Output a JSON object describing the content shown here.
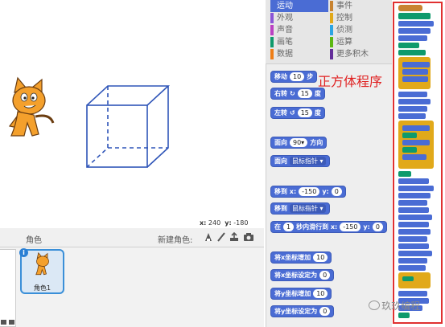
{
  "stage": {
    "coords": {
      "x_label": "x:",
      "x_value": "240",
      "y_label": "y:",
      "y_value": "-180"
    }
  },
  "sprites": {
    "title": "角色",
    "new_sprite_label": "新建角色:",
    "tools": [
      "paint-icon",
      "brush-icon",
      "upload-icon",
      "camera-icon"
    ],
    "tile_label": "角色1",
    "info_badge": "i"
  },
  "categories": {
    "items": [
      {
        "label": "运动",
        "color": "#4a6cd4",
        "selected": true
      },
      {
        "label": "事件",
        "color": "#c88330",
        "selected": false
      },
      {
        "label": "外观",
        "color": "#8a55d7",
        "selected": false
      },
      {
        "label": "控制",
        "color": "#e1a91a",
        "selected": false
      },
      {
        "label": "声音",
        "color": "#bb42c3",
        "selected": false
      },
      {
        "label": "侦测",
        "color": "#2ca5e2",
        "selected": false
      },
      {
        "label": "画笔",
        "color": "#0e9a6c",
        "selected": false
      },
      {
        "label": "运算",
        "color": "#5cb712",
        "selected": false
      },
      {
        "label": "数据",
        "color": "#ee7d16",
        "selected": false
      },
      {
        "label": "更多积木",
        "color": "#632d99",
        "selected": false
      }
    ]
  },
  "blocks": {
    "move": {
      "text": "移动",
      "value": "10",
      "suffix": "步"
    },
    "turn_right": {
      "text": "右转",
      "value": "15",
      "suffix": "度"
    },
    "turn_left": {
      "text": "左转",
      "value": "15",
      "suffix": "度"
    },
    "point_dir": {
      "text": "面向",
      "value": "90▾",
      "suffix": "方向"
    },
    "point_towards": {
      "text": "面向",
      "drop": "鼠标指针 ▾"
    },
    "goto_xy": {
      "text": "移到 x:",
      "x": "-150",
      "y_label": "y:",
      "y": "0"
    },
    "goto": {
      "text": "移到",
      "drop": "鼠标指针 ▾"
    },
    "glide": {
      "text": "在",
      "secs": "1",
      "mid": "秒内滑行到 x:",
      "x": "-150",
      "y_label": "y:",
      "y": "0"
    },
    "change_x": {
      "text": "将x坐标增加",
      "value": "10"
    },
    "set_x": {
      "text": "将x坐标设定为",
      "value": "0"
    },
    "change_y": {
      "text": "将y坐标增加",
      "value": "10"
    },
    "set_y": {
      "text": "将y坐标设定为",
      "value": "0"
    }
  },
  "annotation": "正方体程序",
  "watermark": "玖玖编程"
}
